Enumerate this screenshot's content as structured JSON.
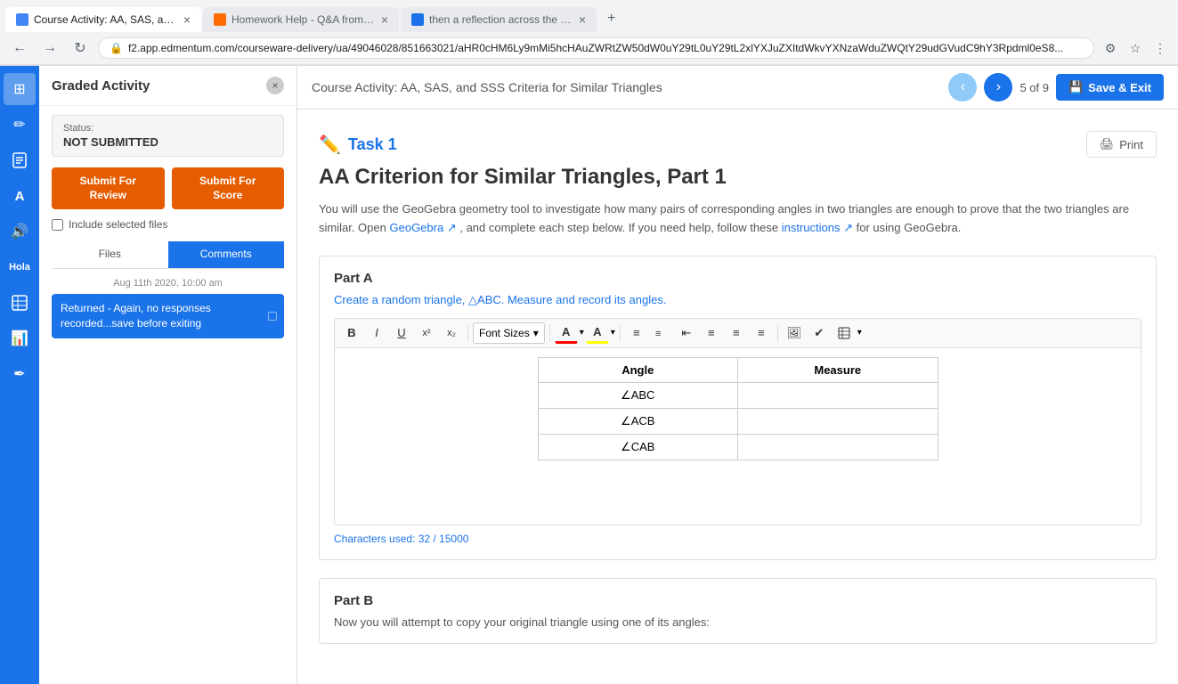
{
  "browser": {
    "tabs": [
      {
        "id": "tab1",
        "favicon_color": "#4285f4",
        "label": "Course Activity: AA, SAS, and SS",
        "active": true
      },
      {
        "id": "tab2",
        "favicon_color": "#ff6d00",
        "label": "Homework Help - Q&A from Onli",
        "active": false
      },
      {
        "id": "tab3",
        "favicon_color": "#1a73e8",
        "label": "then a reflection across the x ax",
        "active": false
      }
    ],
    "url": "f2.app.edmentum.com/courseware-delivery/ua/49046028/851663021/aHR0cHM6Ly9mMi5hcHAuZWRtZW50dW0uY29tL0uY29tL2xlYXJuZXItdWkvYXNzaWduZWQtY29udGVudC9hY3Rpdml0eS8..."
  },
  "sidebar": {
    "icons": [
      {
        "name": "grid-icon",
        "symbol": "⊞"
      },
      {
        "name": "edit-icon",
        "symbol": "✏"
      },
      {
        "name": "assignment-icon",
        "symbol": "📋"
      },
      {
        "name": "font-icon",
        "symbol": "A"
      },
      {
        "name": "audio-icon",
        "symbol": "🔊"
      },
      {
        "name": "hola-icon",
        "symbol": "👋"
      },
      {
        "name": "table-icon",
        "symbol": "⊞"
      },
      {
        "name": "chart-icon",
        "symbol": "📊"
      },
      {
        "name": "pen-icon",
        "symbol": "✒"
      }
    ]
  },
  "panel": {
    "title": "Graded Activity",
    "status_label": "Status:",
    "status_value": "NOT SUBMITTED",
    "btn_review": "Submit For\nReview",
    "btn_score": "Submit For\nScore",
    "include_files_label": "Include selected files",
    "tabs": [
      "Files",
      "Comments"
    ],
    "active_tab": "Comments",
    "comment_timestamp": "Aug 11th 2020, 10:00 am",
    "comment_text": "Returned - Again, no responses recorded...save before exiting"
  },
  "header": {
    "title": "Course Activity: AA, SAS, and SSS Criteria for Similar Triangles",
    "page_current": "5",
    "page_total": "9",
    "page_label": "5 of 9",
    "save_exit_label": "Save & Exit",
    "prev_arrow": "‹",
    "next_arrow": "›"
  },
  "task": {
    "icon": "✏️",
    "label": "Task 1",
    "print_label": "Print",
    "title": "AA Criterion for Similar Triangles, Part 1",
    "description": "You will use the GeoGebra geometry tool to investigate how many pairs of corresponding angles in two triangles are enough to prove that the two triangles are similar. Open",
    "geogebra_link": "GeoGebra",
    "description2": ", and complete each step below. If you need help, follow these",
    "instructions_link": "instructions",
    "description3": "for using GeoGebra.",
    "part_a": {
      "title": "Part A",
      "description": "Create a random triangle, △ABC. Measure and record its angles.",
      "toolbar": {
        "bold": "B",
        "italic": "I",
        "underline": "U",
        "superscript": "x²",
        "subscript": "x₂",
        "font_sizes": "Font Sizes",
        "font_color": "A",
        "bg_color": "A"
      },
      "table": {
        "headers": [
          "Angle",
          "Measure"
        ],
        "rows": [
          [
            "∠ABC",
            ""
          ],
          [
            "∠ACB",
            ""
          ],
          [
            "∠CAB",
            ""
          ]
        ]
      },
      "chars_used": "Characters used: 32 / 15000"
    },
    "part_b": {
      "title": "Part B",
      "description": "Now you will attempt to copy your original triangle using one of its angles:"
    }
  }
}
